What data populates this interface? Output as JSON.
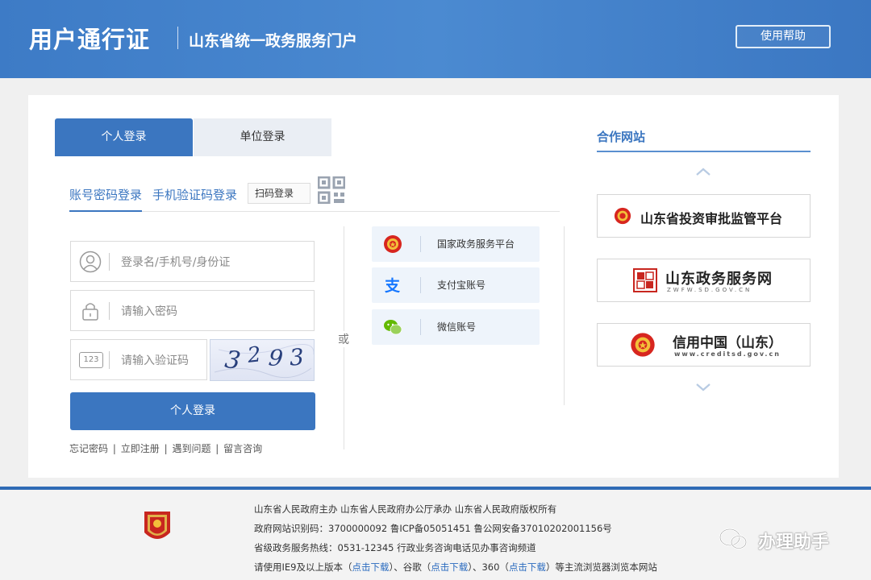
{
  "header": {
    "brand": "用户通行证",
    "subtitle": "山东省统一政务服务门户",
    "help_button": "使用帮助"
  },
  "login": {
    "tabs": [
      "个人登录",
      "单位登录"
    ],
    "subtabs": [
      "账号密码登录",
      "手机验证码登录",
      "扫码登录"
    ],
    "fields": {
      "username_placeholder": "登录名/手机号/身份证",
      "password_placeholder": "请输入密码",
      "captcha_placeholder": "请输入验证码",
      "captcha_icon_text": "123",
      "captcha_digits": [
        "3",
        "2",
        "9",
        "3"
      ]
    },
    "submit": "个人登录",
    "links": [
      "忘记密码",
      "立即注册",
      "遇到问题",
      "留言咨询"
    ],
    "or_label": "或",
    "third_party": [
      "国家政务服务平台",
      "支付宝账号",
      "微信账号"
    ]
  },
  "partners": {
    "title": "合作网站",
    "items": [
      {
        "name": "山东省投资审批监管平台"
      },
      {
        "name": "山东政务服务网",
        "sub": "ZWFW.SD.GOV.CN"
      },
      {
        "name": "信用中国（山东）",
        "sub": "www.creditsd.gov.cn"
      }
    ]
  },
  "footer": {
    "line1": "山东省人民政府主办    山东省人民政府办公厅承办    山东省人民政府版权所有",
    "line2": "政府网站识别码：3700000092    鲁ICP备05051451    鲁公网安备37010202001156号",
    "line3": "省级政务服务热线：0531-12345    行政业务咨询电话见办事咨询频道",
    "line4_prefix": "请使用IE9及以上版本（",
    "line4_link1": "点击下载",
    "line4_mid1": "）、谷歌（",
    "line4_link2": "点击下载",
    "line4_mid2": "）、360（",
    "line4_link3": "点击下载",
    "line4_suffix": "）等主流浏览器浏览本网站",
    "emblem_text": "党政机关"
  },
  "watermark": "办理助手",
  "colors": {
    "primary": "#3b76c0",
    "header_bg": "#4483cc",
    "tab_inactive": "#eaeef4",
    "third_bg": "#eef4fb"
  }
}
